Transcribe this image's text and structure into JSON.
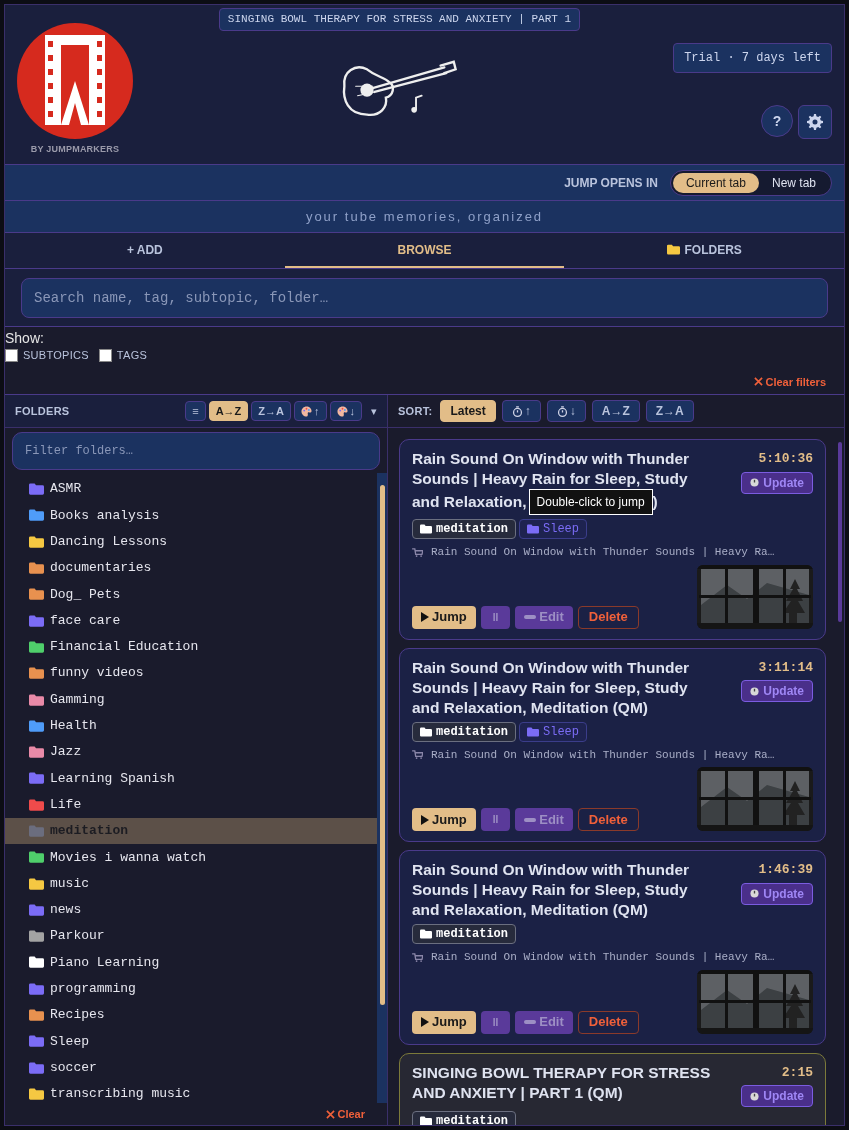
{
  "header": {
    "now_playing": "SINGING BOWL THERAPY FOR STRESS AND ANXIETY | PART 1",
    "brand": "BY JUMPMARKERS",
    "trial": "Trial · 7 days left",
    "help": "?"
  },
  "jump_opens": {
    "label": "JUMP OPENS IN",
    "options": [
      {
        "label": "Current tab",
        "selected": true
      },
      {
        "label": "New tab",
        "selected": false
      }
    ]
  },
  "tagline": "your tube memories, organized",
  "tabs": [
    {
      "label": "+ ADD",
      "kind": "plain",
      "selected": false
    },
    {
      "label": "BROWSE",
      "kind": "plain",
      "selected": true
    },
    {
      "label": "FOLDERS",
      "kind": "folder",
      "selected": false
    }
  ],
  "search": {
    "placeholder": "Search name, tag, subtopic, folder…"
  },
  "show": {
    "label": "Show:",
    "options": [
      {
        "label": "SUBTOPICS",
        "checked": false
      },
      {
        "label": "TAGS",
        "checked": false
      }
    ]
  },
  "clear_filters": "Clear filters",
  "folders_panel": {
    "title": "FOLDERS",
    "sorts": [
      {
        "label": "≡",
        "kind": "text",
        "selected": false
      },
      {
        "label": "A→Z",
        "kind": "text",
        "selected": true
      },
      {
        "label": "Z→A",
        "kind": "text",
        "selected": false
      },
      {
        "label": "↑",
        "kind": "palette",
        "selected": false
      },
      {
        "label": "↓",
        "kind": "palette",
        "selected": false
      }
    ],
    "more": "▾",
    "filter_placeholder": "Filter folders…",
    "clear": "Clear",
    "items": [
      {
        "name": "ASMR",
        "color": "#7b6cf6",
        "selected": false
      },
      {
        "name": "Books analysis",
        "color": "#4f9cf9",
        "selected": false
      },
      {
        "name": "Dancing Lessons",
        "color": "#f5c842",
        "selected": false
      },
      {
        "name": "documentaries",
        "color": "#e8914f",
        "selected": false
      },
      {
        "name": "Dog_ Pets",
        "color": "#e8914f",
        "selected": false
      },
      {
        "name": "face care",
        "color": "#7b6cf6",
        "selected": false
      },
      {
        "name": "Financial Education",
        "color": "#4fcf6b",
        "selected": false
      },
      {
        "name": "funny videos",
        "color": "#e8914f",
        "selected": false
      },
      {
        "name": "Gamming",
        "color": "#e98aa8",
        "selected": false
      },
      {
        "name": "Health",
        "color": "#4f9cf9",
        "selected": false
      },
      {
        "name": "Jazz",
        "color": "#e98aa8",
        "selected": false
      },
      {
        "name": "Learning Spanish",
        "color": "#7b6cf6",
        "selected": false
      },
      {
        "name": "Life",
        "color": "#ef4b4b",
        "selected": false
      },
      {
        "name": "meditation",
        "color": "#6b6d7e",
        "selected": true
      },
      {
        "name": "Movies i wanna watch",
        "color": "#4fcf6b",
        "selected": false
      },
      {
        "name": "music",
        "color": "#f5c842",
        "selected": false
      },
      {
        "name": "news",
        "color": "#7b6cf6",
        "selected": false
      },
      {
        "name": "Parkour",
        "color": "#a3a3a3",
        "selected": false
      },
      {
        "name": "Piano Learning",
        "color": "#ffffff",
        "selected": false
      },
      {
        "name": "programming",
        "color": "#7b6cf6",
        "selected": false
      },
      {
        "name": "Recipes",
        "color": "#e8914f",
        "selected": false
      },
      {
        "name": "Sleep",
        "color": "#7b6cf6",
        "selected": false
      },
      {
        "name": "soccer",
        "color": "#7b6cf6",
        "selected": false
      },
      {
        "name": "transcribing music",
        "color": "#f5c842",
        "selected": false
      }
    ]
  },
  "videos_panel": {
    "sort_label": "SORT:",
    "sorts": [
      {
        "label": "Latest",
        "kind": "text",
        "selected": true
      },
      {
        "label": "↑",
        "kind": "timer",
        "selected": false
      },
      {
        "label": "↓",
        "kind": "timer",
        "selected": false
      },
      {
        "label": "A→Z",
        "kind": "text",
        "selected": false
      },
      {
        "label": "Z→A",
        "kind": "text",
        "selected": false
      }
    ],
    "tooltip": "Double-click to jump",
    "videos": [
      {
        "title": "Rain Sound On Window with Thunder Sounds | Heavy Rain for Sleep, Study",
        "title_continued": "and Relaxation,",
        "title_tail": ")",
        "duration": "5:10:36",
        "playing": false,
        "folders": [
          {
            "name": "meditation",
            "color": "#ffffff"
          },
          {
            "name": "Sleep",
            "color": "#7b6cf6"
          }
        ],
        "channel": "Rain Sound On Window with Thunder Sounds | Heavy Ra…",
        "thumbnail": {
          "kind": "picture"
        },
        "update": "Update",
        "jump": "Jump",
        "pause": "II",
        "edit": "Edit",
        "delete": "Delete"
      },
      {
        "title": "Rain Sound On Window with Thunder Sounds | Heavy Rain for Sleep, Study and Relaxation, Meditation (QM)",
        "duration": "3:11:14",
        "playing": false,
        "folders": [
          {
            "name": "meditation",
            "color": "#ffffff"
          },
          {
            "name": "Sleep",
            "color": "#7b6cf6"
          }
        ],
        "channel": "Rain Sound On Window with Thunder Sounds | Heavy Ra…",
        "thumbnail": {
          "kind": "picture"
        },
        "update": "Update",
        "jump": "Jump",
        "pause": "II",
        "edit": "Edit",
        "delete": "Delete"
      },
      {
        "title": "Rain Sound On Window with Thunder Sounds | Heavy Rain for Sleep, Study and Relaxation, Meditation (QM)",
        "duration": "1:46:39",
        "playing": false,
        "folders": [
          {
            "name": "meditation",
            "color": "#ffffff"
          }
        ],
        "channel": "Rain Sound On Window with Thunder Sounds | Heavy Ra…",
        "thumbnail": {
          "kind": "picture"
        },
        "update": "Update",
        "jump": "Jump",
        "pause": "II",
        "edit": "Edit",
        "delete": "Delete"
      },
      {
        "title": "SINGING BOWL THERAPY FOR STRESS AND ANXIETY | PART 1 (QM)",
        "duration": "2:15",
        "playing": true,
        "folders": [
          {
            "name": "meditation",
            "color": "#ffffff"
          }
        ],
        "update": "Update"
      }
    ]
  }
}
